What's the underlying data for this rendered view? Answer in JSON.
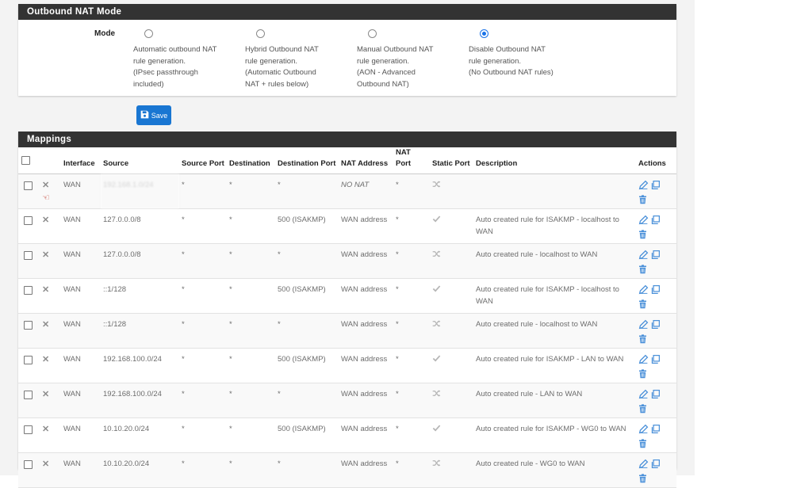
{
  "mode_panel": {
    "title": "Outbound NAT Mode",
    "mode_label": "Mode",
    "options": [
      {
        "label": "Automatic outbound NAT\nrule generation.\n(IPsec passthrough\nincluded)",
        "checked": false
      },
      {
        "label": "Hybrid Outbound NAT\nrule generation.\n(Automatic Outbound\nNAT + rules below)",
        "checked": false
      },
      {
        "label": "Manual Outbound NAT\nrule generation.\n(AON - Advanced\nOutbound NAT)",
        "checked": false
      },
      {
        "label": "Disable Outbound NAT\nrule generation.\n(No Outbound NAT rules)",
        "checked": true
      }
    ]
  },
  "save_button": {
    "label": "Save"
  },
  "mappings": {
    "title": "Mappings",
    "headers": {
      "interface": "Interface",
      "source": "Source",
      "source_port": "Source Port",
      "destination": "Destination",
      "destination_port": "Destination Port",
      "nat_address": "NAT Address",
      "nat_port": "NAT Port",
      "static_port": "Static Port",
      "description": "Description",
      "actions": "Actions"
    },
    "rows": [
      {
        "interface": "WAN",
        "source": "192.168.1.0/24",
        "source_port": "*",
        "destination": "*",
        "destination_port": "*",
        "nat_address": "NO NAT",
        "nat_port": "*",
        "static": "shuffle",
        "description": "",
        "no_nat": true
      },
      {
        "interface": "WAN",
        "source": "127.0.0.0/8",
        "source_port": "*",
        "destination": "*",
        "destination_port": "500 (ISAKMP)",
        "nat_address": "WAN address",
        "nat_port": "*",
        "static": "check",
        "description": "Auto created rule for ISAKMP - localhost to WAN"
      },
      {
        "interface": "WAN",
        "source": "127.0.0.0/8",
        "source_port": "*",
        "destination": "*",
        "destination_port": "*",
        "nat_address": "WAN address",
        "nat_port": "*",
        "static": "shuffle",
        "description": "Auto created rule - localhost to WAN"
      },
      {
        "interface": "WAN",
        "source": "::1/128",
        "source_port": "*",
        "destination": "*",
        "destination_port": "500 (ISAKMP)",
        "nat_address": "WAN address",
        "nat_port": "*",
        "static": "check",
        "description": "Auto created rule for ISAKMP - localhost to WAN"
      },
      {
        "interface": "WAN",
        "source": "::1/128",
        "source_port": "*",
        "destination": "*",
        "destination_port": "*",
        "nat_address": "WAN address",
        "nat_port": "*",
        "static": "shuffle",
        "description": "Auto created rule - localhost to WAN"
      },
      {
        "interface": "WAN",
        "source": "192.168.100.0/24",
        "source_port": "*",
        "destination": "*",
        "destination_port": "500 (ISAKMP)",
        "nat_address": "WAN address",
        "nat_port": "*",
        "static": "check",
        "description": "Auto created rule for ISAKMP - LAN to WAN"
      },
      {
        "interface": "WAN",
        "source": "192.168.100.0/24",
        "source_port": "*",
        "destination": "*",
        "destination_port": "*",
        "nat_address": "WAN address",
        "nat_port": "*",
        "static": "shuffle",
        "description": "Auto created rule - LAN to WAN"
      },
      {
        "interface": "WAN",
        "source": "10.10.20.0/24",
        "source_port": "*",
        "destination": "*",
        "destination_port": "500 (ISAKMP)",
        "nat_address": "WAN address",
        "nat_port": "*",
        "static": "check",
        "description": "Auto created rule for ISAKMP - WG0 to WAN"
      },
      {
        "interface": "WAN",
        "source": "10.10.20.0/24",
        "source_port": "*",
        "destination": "*",
        "destination_port": "*",
        "nat_address": "WAN address",
        "nat_port": "*",
        "static": "shuffle",
        "description": "Auto created rule - WG0 to WAN"
      }
    ]
  },
  "colors": {
    "accent": "#1976d2",
    "heading_bg": "#333333",
    "action_icon": "#4a90d9"
  },
  "icons": [
    "times-icon",
    "hand-pointer-icon",
    "shuffle-icon",
    "check-icon",
    "pencil-icon",
    "copy-icon",
    "trash-icon",
    "save-icon"
  ]
}
